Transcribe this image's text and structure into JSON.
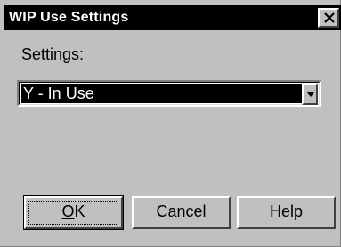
{
  "window": {
    "title": "WIP Use Settings",
    "close_icon": "close-x-icon"
  },
  "form": {
    "settings_label": "Settings:",
    "settings_value": "Y - In Use",
    "dropdown_icon": "chevron-down-icon"
  },
  "buttons": {
    "ok_mnemonic": "O",
    "ok_rest": "K",
    "cancel_label": "Cancel",
    "help_label": "Help"
  },
  "colors": {
    "titlebar": "#000000",
    "selection": "#000000",
    "face": "#c0c0c0"
  }
}
